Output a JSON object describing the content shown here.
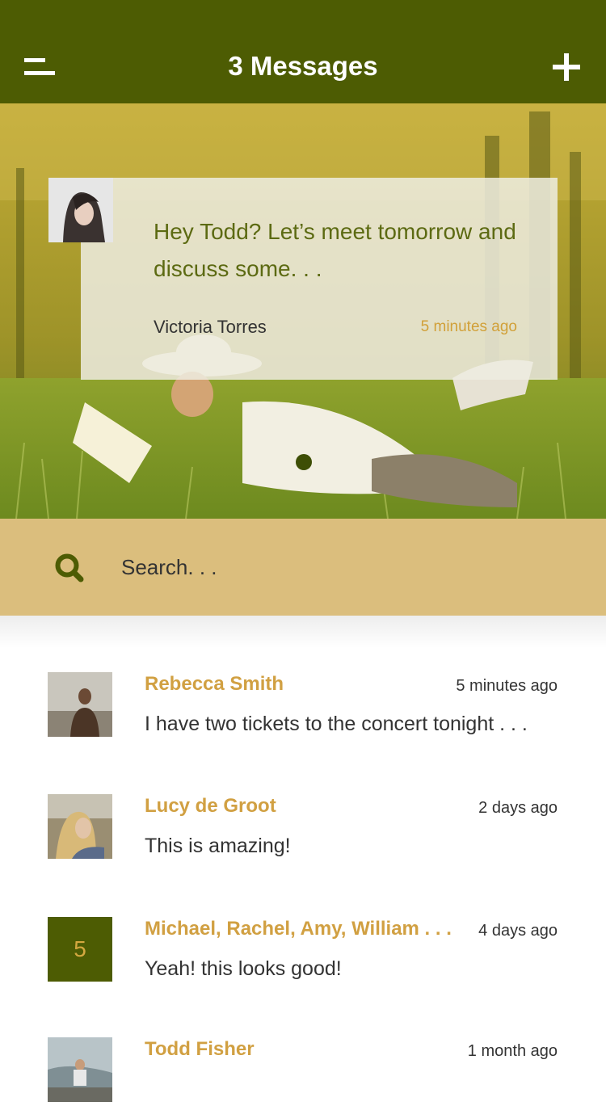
{
  "header": {
    "title": "3 Messages",
    "menu_icon": "menu-icon",
    "add_icon": "plus-icon"
  },
  "featured": {
    "text": "Hey Todd? Let’s meet tomorrow and discuss some. . .",
    "sender": "Victoria Torres",
    "time": "5 minutes ago"
  },
  "search": {
    "placeholder": "Search. . .",
    "icon": "search-icon"
  },
  "messages": [
    {
      "name": "Rebecca Smith",
      "time": "5 minutes ago",
      "preview": "I have two tickets to the concert tonight . . ."
    },
    {
      "name": "Lucy de Groot",
      "time": "2 days ago",
      "preview": "This is amazing!"
    },
    {
      "name": "Michael, Rachel, Amy, William . . .",
      "time": "4 days ago",
      "preview": "Yeah! this looks good!",
      "count": "5"
    },
    {
      "name": "Todd Fisher",
      "time": "1 month ago",
      "preview": ""
    }
  ],
  "colors": {
    "header": "#4d5c03",
    "accent": "#d1a042",
    "search_bg": "#dbbe7d"
  }
}
